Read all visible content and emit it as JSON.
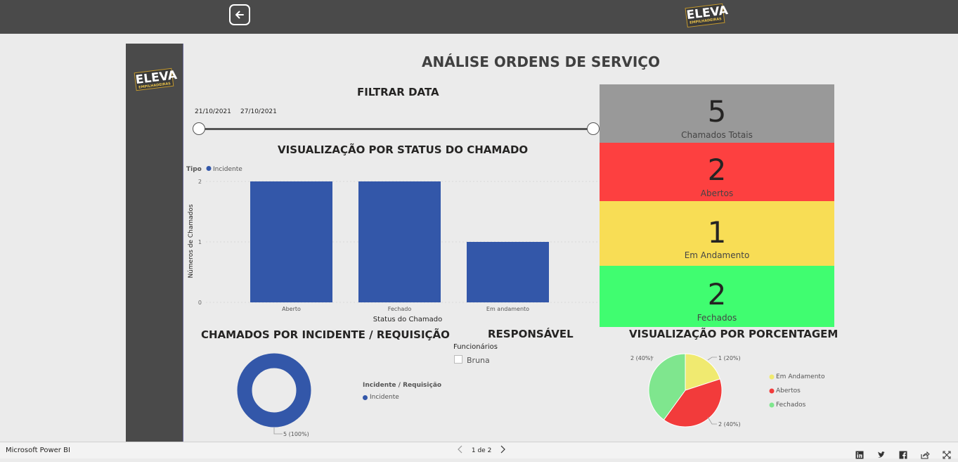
{
  "header": {
    "back_icon": "arrow-left-icon",
    "logo_main": "ELEVA",
    "logo_sub": "EMPILHADEIRAS"
  },
  "page": {
    "title": "ANÁLISE ORDENS DE SERVIÇO"
  },
  "date_filter": {
    "title": "FILTRAR DATA",
    "start": "21/10/2021",
    "end": "27/10/2021"
  },
  "kpis": [
    {
      "value": "5",
      "label": "Chamados Totais",
      "color": "#999999"
    },
    {
      "value": "2",
      "label": "Abertos",
      "color": "#fd4040"
    },
    {
      "value": "1",
      "label": "Em Andamento",
      "color": "#f8dd55"
    },
    {
      "value": "2",
      "label": "Fechados",
      "color": "#40fd70"
    }
  ],
  "status_chart": {
    "title": "VISUALIZAÇÃO POR STATUS DO CHAMADO",
    "legend_title": "Tipo",
    "legend_item": "Incidente",
    "ylabel": "Números de Chamados",
    "xlabel": "Status do Chamado",
    "y_ticks": [
      "0",
      "1",
      "2"
    ]
  },
  "incident_chart": {
    "title": "CHAMADOS POR INCIDENTE / REQUISIÇÃO",
    "legend_title": "Incidente / Requisição",
    "legend_item": "Incidente",
    "data_label": "5 (100%)"
  },
  "responsavel": {
    "title": "RESPONSÁVEL",
    "subtitle": "Funcionários",
    "item": "Bruna"
  },
  "pct_chart": {
    "title": "VISUALIZAÇÃO POR PORCENTAGEM",
    "legend": [
      "Em Andamento",
      "Abertos",
      "Fechados"
    ],
    "labels": [
      "1 (20%)",
      "2 (40%)",
      "2 (40%)"
    ]
  },
  "chart_data": [
    {
      "type": "bar",
      "categories": [
        "Aberto",
        "Fechado",
        "Em andamento"
      ],
      "series": [
        {
          "name": "Incidente",
          "values": [
            2,
            2,
            1
          ],
          "color": "#3357a9"
        }
      ],
      "title": "VISUALIZAÇÃO POR STATUS DO CHAMADO",
      "xlabel": "Status do Chamado",
      "ylabel": "Números de Chamados",
      "ylim": [
        0,
        2
      ],
      "legend": "top-left"
    },
    {
      "type": "pie",
      "categories": [
        "Incidente"
      ],
      "values": [
        5
      ],
      "colors": [
        "#3357a9"
      ],
      "title": "CHAMADOS POR INCIDENTE / REQUISIÇÃO",
      "labels": [
        "5 (100%)"
      ]
    },
    {
      "type": "pie",
      "categories": [
        "Em Andamento",
        "Abertos",
        "Fechados"
      ],
      "values": [
        1,
        2,
        2
      ],
      "colors": [
        "#f0ea70",
        "#f23b3b",
        "#7fe68e"
      ],
      "title": "VISUALIZAÇÃO POR PORCENTAGEM",
      "labels": [
        "1 (20%)",
        "2 (40%)",
        "2 (40%)"
      ]
    }
  ],
  "footer": {
    "brand": "Microsoft Power BI",
    "page_indicator": "1 de 2",
    "share_icons": [
      "linkedin-icon",
      "twitter-icon",
      "facebook-icon",
      "share-icon",
      "fullscreen-icon"
    ]
  }
}
